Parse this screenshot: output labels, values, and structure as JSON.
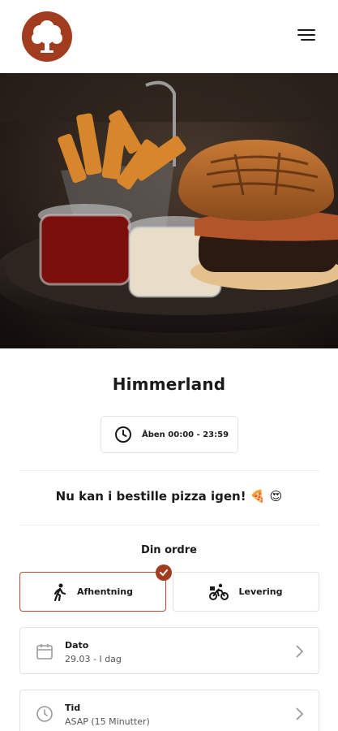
{
  "header": {
    "logo_icon": "tree-logo-icon",
    "menu_icon": "hamburger-menu-icon",
    "brand_color": "#a13c1e"
  },
  "hero": {
    "image": "burger-and-fries-photo"
  },
  "restaurant": {
    "name": "Himmerland",
    "hours": "Åben 00:00 - 23:59",
    "hours_icon": "clock-icon",
    "notice": "Nu kan i bestille pizza igen! 🍕 😍"
  },
  "order": {
    "heading": "Din ordre",
    "options": [
      {
        "label": "Afhentning",
        "icon": "walking-person-icon",
        "selected": true
      },
      {
        "label": "Levering",
        "icon": "bicycle-icon",
        "selected": false
      }
    ],
    "date": {
      "label": "Dato",
      "value": "29.03 - I dag",
      "icon": "calendar-icon"
    },
    "time": {
      "label": "Tid",
      "value": "ASAP (15 Minutter)",
      "icon": "clock-icon"
    }
  }
}
